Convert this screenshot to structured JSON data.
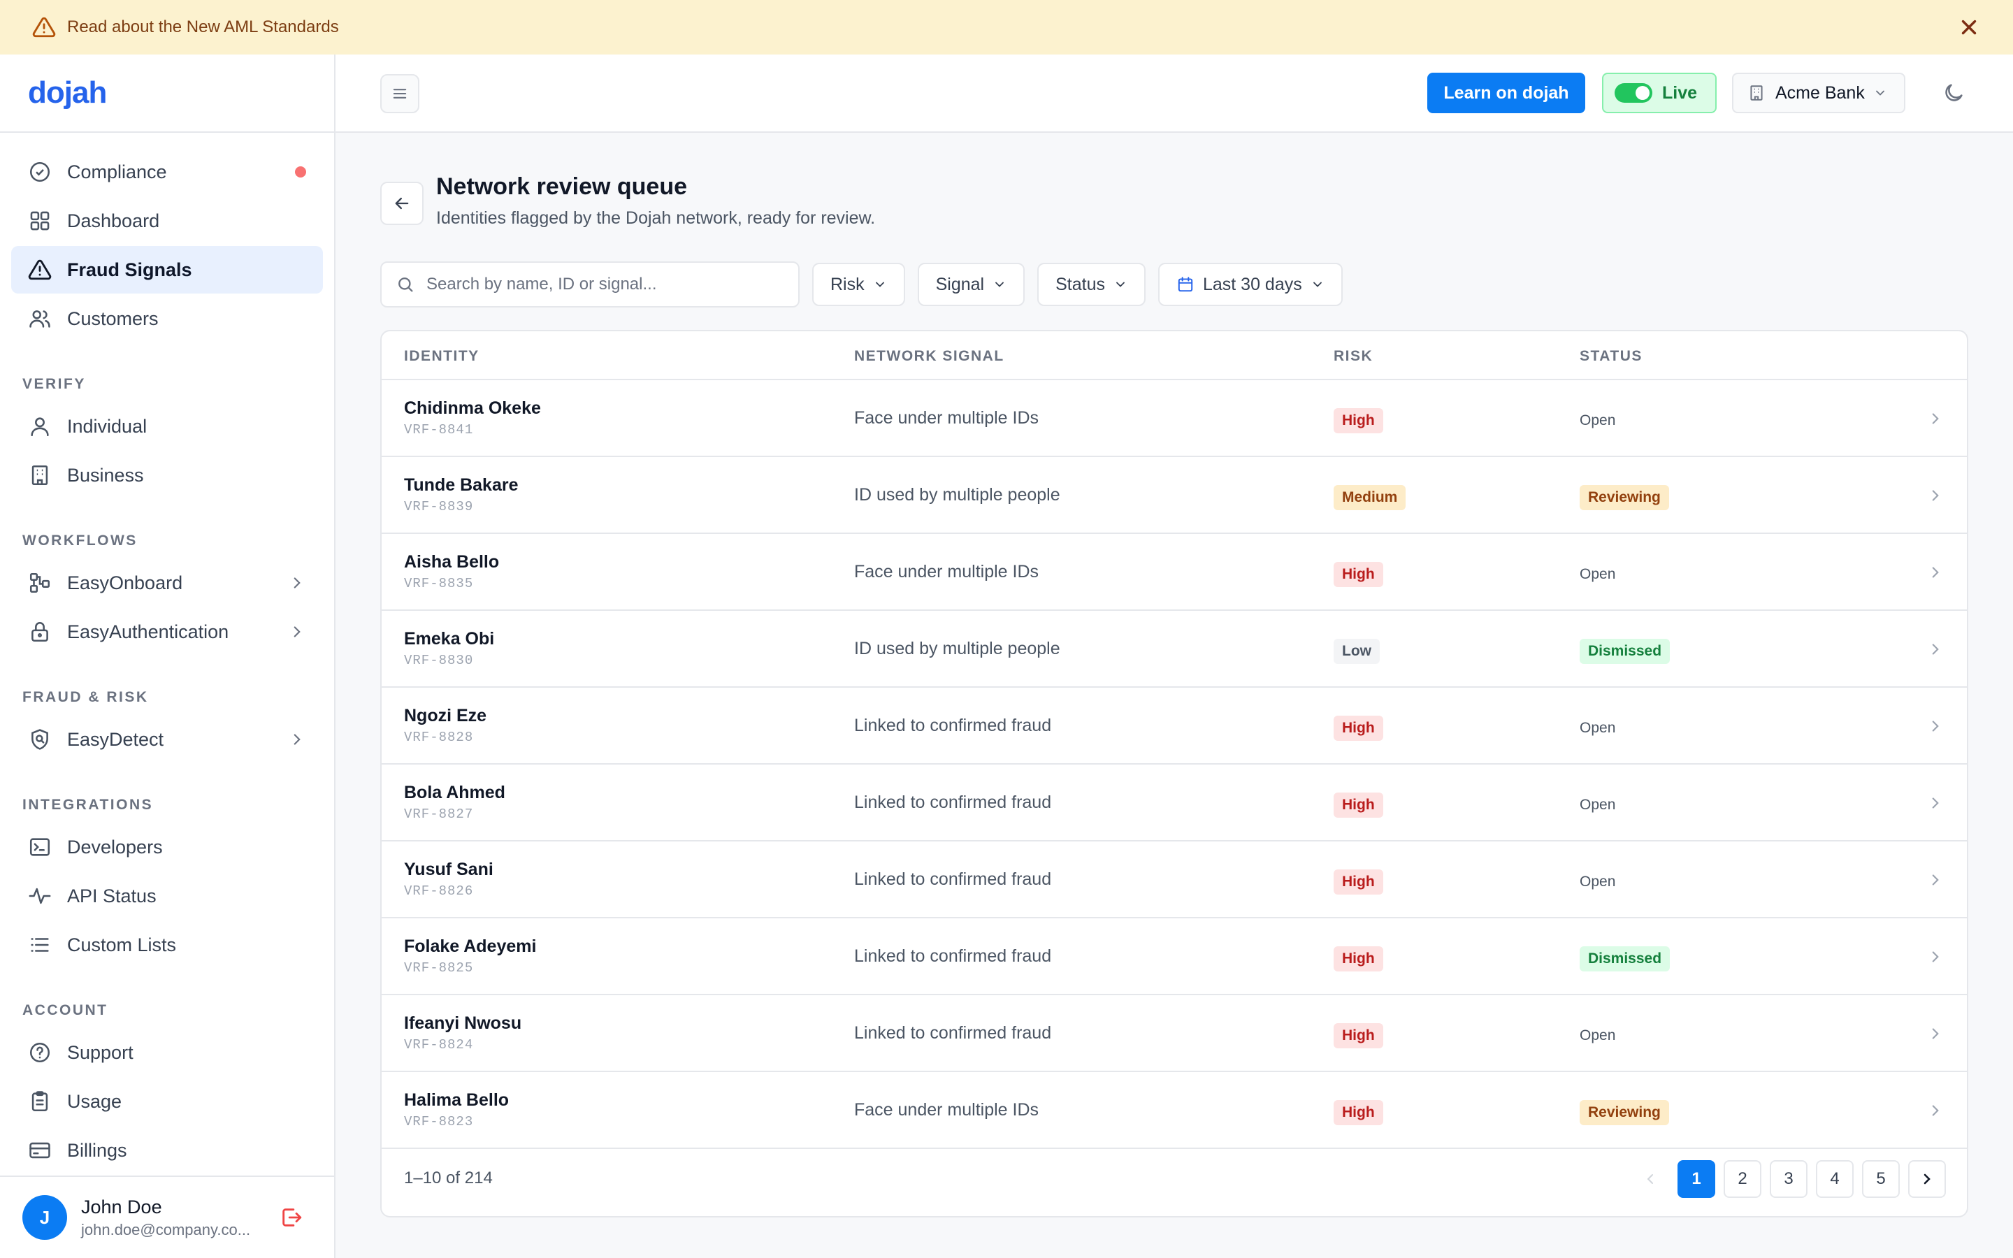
{
  "banner": {
    "text": "Read about the New AML Standards"
  },
  "logo": "dojah",
  "sidebar": {
    "top_items": [
      {
        "label": "Compliance"
      },
      {
        "label": "Dashboard"
      },
      {
        "label": "Fraud Signals"
      },
      {
        "label": "Customers"
      }
    ],
    "sections": {
      "verify": {
        "label": "VERIFY",
        "items": [
          {
            "label": "Individual"
          },
          {
            "label": "Business"
          }
        ]
      },
      "workflows": {
        "label": "WORKFLOWS",
        "items": [
          {
            "label": "EasyOnboard"
          },
          {
            "label": "EasyAuthentication"
          }
        ]
      },
      "fraud": {
        "label": "FRAUD & RISK",
        "items": [
          {
            "label": "EasyDetect"
          }
        ]
      },
      "integrations": {
        "label": "INTEGRATIONS",
        "items": [
          {
            "label": "Developers"
          },
          {
            "label": "API Status"
          },
          {
            "label": "Custom Lists"
          }
        ]
      },
      "account": {
        "label": "ACCOUNT",
        "items": [
          {
            "label": "Support"
          },
          {
            "label": "Usage"
          },
          {
            "label": "Billings"
          }
        ]
      }
    },
    "user": {
      "initial": "J",
      "name": "John Doe",
      "email": "john.doe@company.co..."
    }
  },
  "topbar": {
    "learn_label": "Learn on dojah",
    "live_label": "Live",
    "org_label": "Acme Bank"
  },
  "page": {
    "title": "Network review queue",
    "subtitle": "Identities flagged by the Dojah network, ready for review."
  },
  "filters": {
    "search_placeholder": "Search by name, ID or signal...",
    "risk": "Risk",
    "signal": "Signal",
    "status": "Status",
    "date": "Last 30 days"
  },
  "table": {
    "columns": {
      "identity": "IDENTITY",
      "signal": "NETWORK SIGNAL",
      "risk": "RISK",
      "status": "STATUS"
    },
    "rows": [
      {
        "name": "Chidinma Okeke",
        "id": "VRF-8841",
        "signal": "Face under multiple IDs",
        "risk": "High",
        "status": "Open"
      },
      {
        "name": "Tunde Bakare",
        "id": "VRF-8839",
        "signal": "ID used by multiple people",
        "risk": "Medium",
        "status": "Reviewing"
      },
      {
        "name": "Aisha Bello",
        "id": "VRF-8835",
        "signal": "Face under multiple IDs",
        "risk": "High",
        "status": "Open"
      },
      {
        "name": "Emeka Obi",
        "id": "VRF-8830",
        "signal": "ID used by multiple people",
        "risk": "Low",
        "status": "Dismissed"
      },
      {
        "name": "Ngozi Eze",
        "id": "VRF-8828",
        "signal": "Linked to confirmed fraud",
        "risk": "High",
        "status": "Open"
      },
      {
        "name": "Bola Ahmed",
        "id": "VRF-8827",
        "signal": "Linked to confirmed fraud",
        "risk": "High",
        "status": "Open"
      },
      {
        "name": "Yusuf Sani",
        "id": "VRF-8826",
        "signal": "Linked to confirmed fraud",
        "risk": "High",
        "status": "Open"
      },
      {
        "name": "Folake Adeyemi",
        "id": "VRF-8825",
        "signal": "Linked to confirmed fraud",
        "risk": "High",
        "status": "Dismissed"
      },
      {
        "name": "Ifeanyi Nwosu",
        "id": "VRF-8824",
        "signal": "Linked to confirmed fraud",
        "risk": "High",
        "status": "Open"
      },
      {
        "name": "Halima Bello",
        "id": "VRF-8823",
        "signal": "Face under multiple IDs",
        "risk": "High",
        "status": "Reviewing"
      }
    ],
    "range_text": "1–10 of 214",
    "pages": [
      "1",
      "2",
      "3",
      "4",
      "5"
    ]
  }
}
